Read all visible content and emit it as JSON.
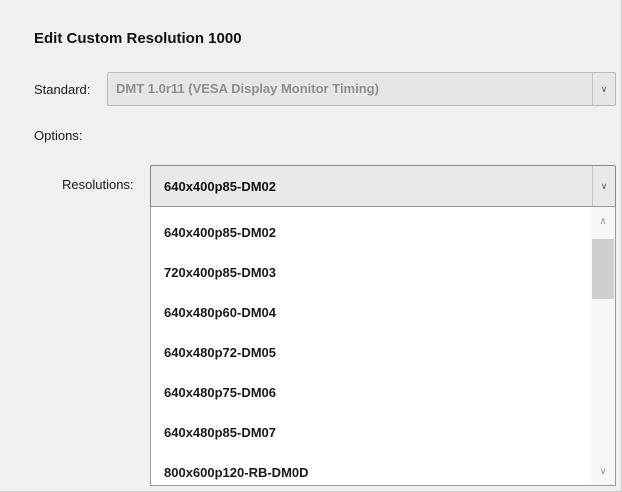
{
  "dialog": {
    "title": "Edit Custom Resolution 1000"
  },
  "standard": {
    "label": "Standard:",
    "value": "DMT 1.0r11 (VESA Display Monitor Timing)",
    "enabled": false
  },
  "options": {
    "label": "Options:"
  },
  "resolutions": {
    "label": "Resolutions:",
    "selected": "640x400p85-DM02",
    "items": [
      "640x400p85-DM02",
      "720x400p85-DM03",
      "640x480p60-DM04",
      "640x480p72-DM05",
      "640x480p75-DM06",
      "640x480p85-DM07",
      "800x600p120-RB-DM0D"
    ]
  },
  "icons": {
    "combo_arrow": "chevron-down-icon",
    "scroll_up": "chevron-up-icon",
    "scroll_down": "chevron-down-icon"
  },
  "colors": {
    "background": "#f0f0f0",
    "list_background": "#ffffff",
    "disabled_text": "#8e8e8e",
    "scroll_thumb": "#cfcfcf"
  }
}
